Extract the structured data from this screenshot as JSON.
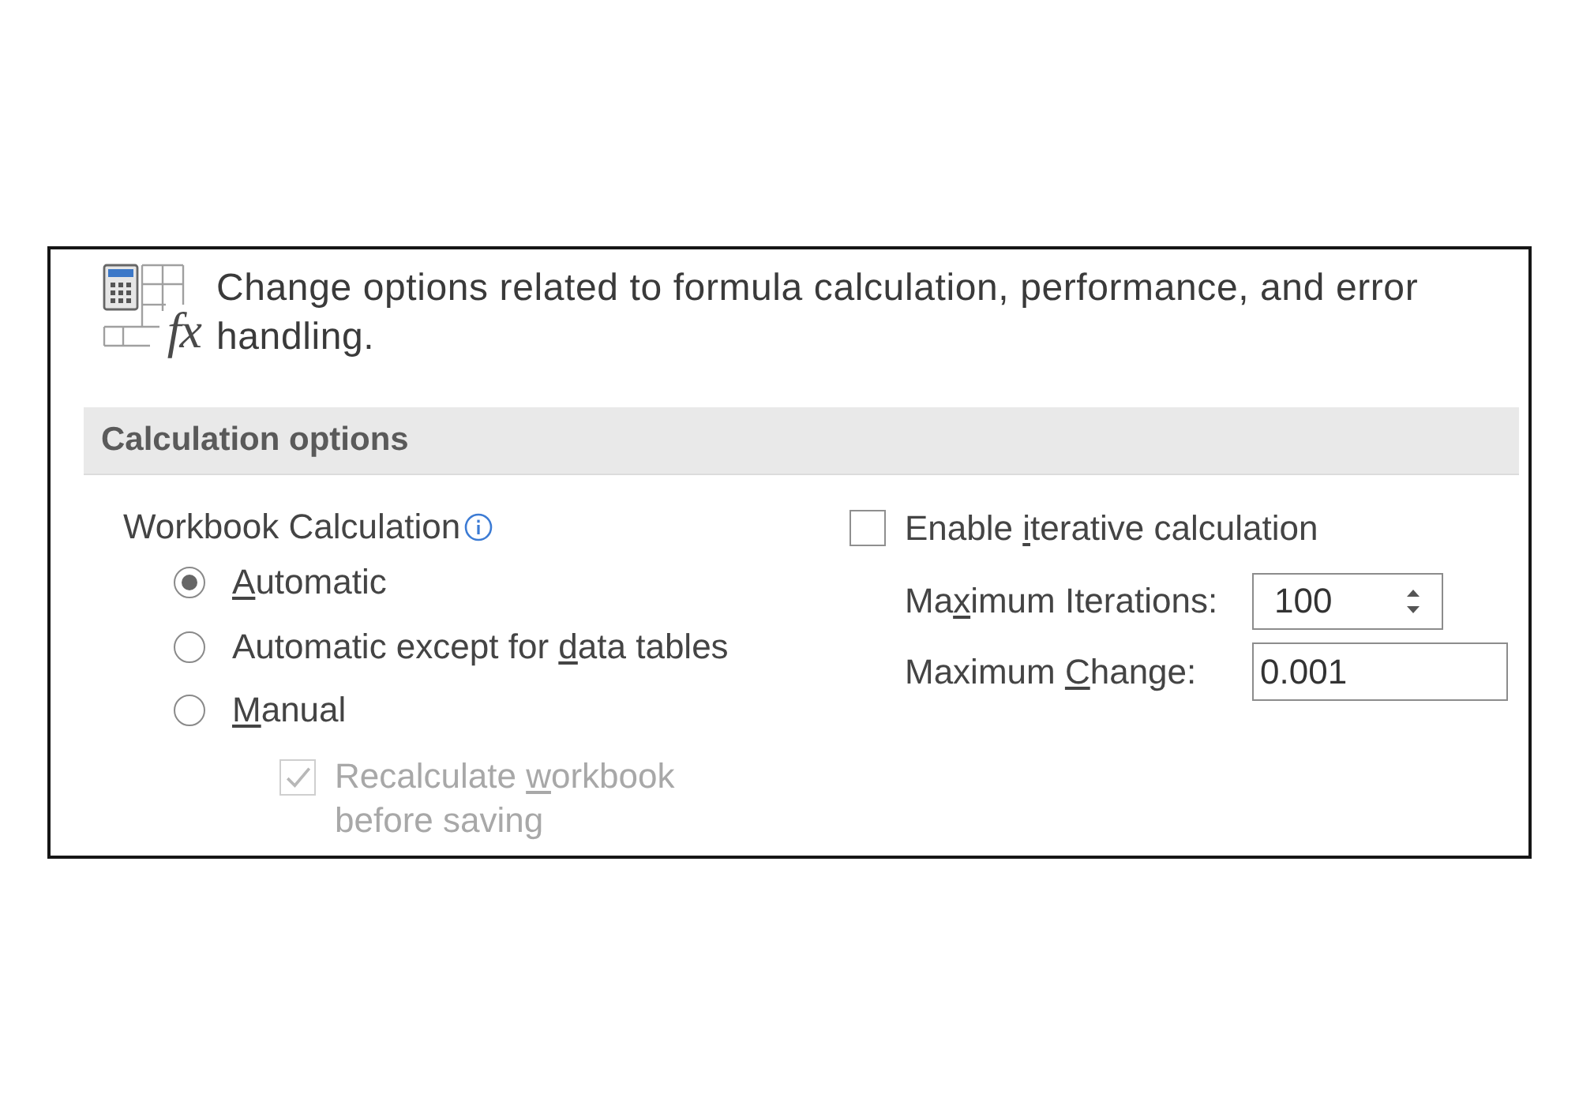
{
  "header": {
    "icon_glyph": "fx",
    "description": "Change options related to formula calculation, performance, and error handling."
  },
  "section": {
    "title": "Calculation options"
  },
  "workbook_calculation": {
    "label": "Workbook Calculation",
    "options": [
      {
        "label": {
          "key": "A",
          "after": "utomatic"
        },
        "selected": true
      },
      {
        "label": {
          "before": "Automatic except for ",
          "key": "d",
          "after": "ata tables"
        },
        "selected": false
      },
      {
        "label": {
          "key": "M",
          "after": "anual"
        },
        "selected": false
      }
    ],
    "recalculate": {
      "label": {
        "before": "Recalculate ",
        "key": "w",
        "after": "orkbook before saving"
      },
      "checked": true,
      "disabled": true
    }
  },
  "iterative": {
    "enable": {
      "label": {
        "before": "Enable ",
        "key": "i",
        "after": "terative calculation"
      },
      "checked": false
    },
    "fields": [
      {
        "kind": "spinner",
        "label": {
          "before": "Ma",
          "key": "x",
          "after": "imum Iterations:"
        },
        "value": "100"
      },
      {
        "kind": "text",
        "label": {
          "before": "Maximum ",
          "key": "C",
          "after": "hange:"
        },
        "value": "0.001"
      }
    ]
  }
}
